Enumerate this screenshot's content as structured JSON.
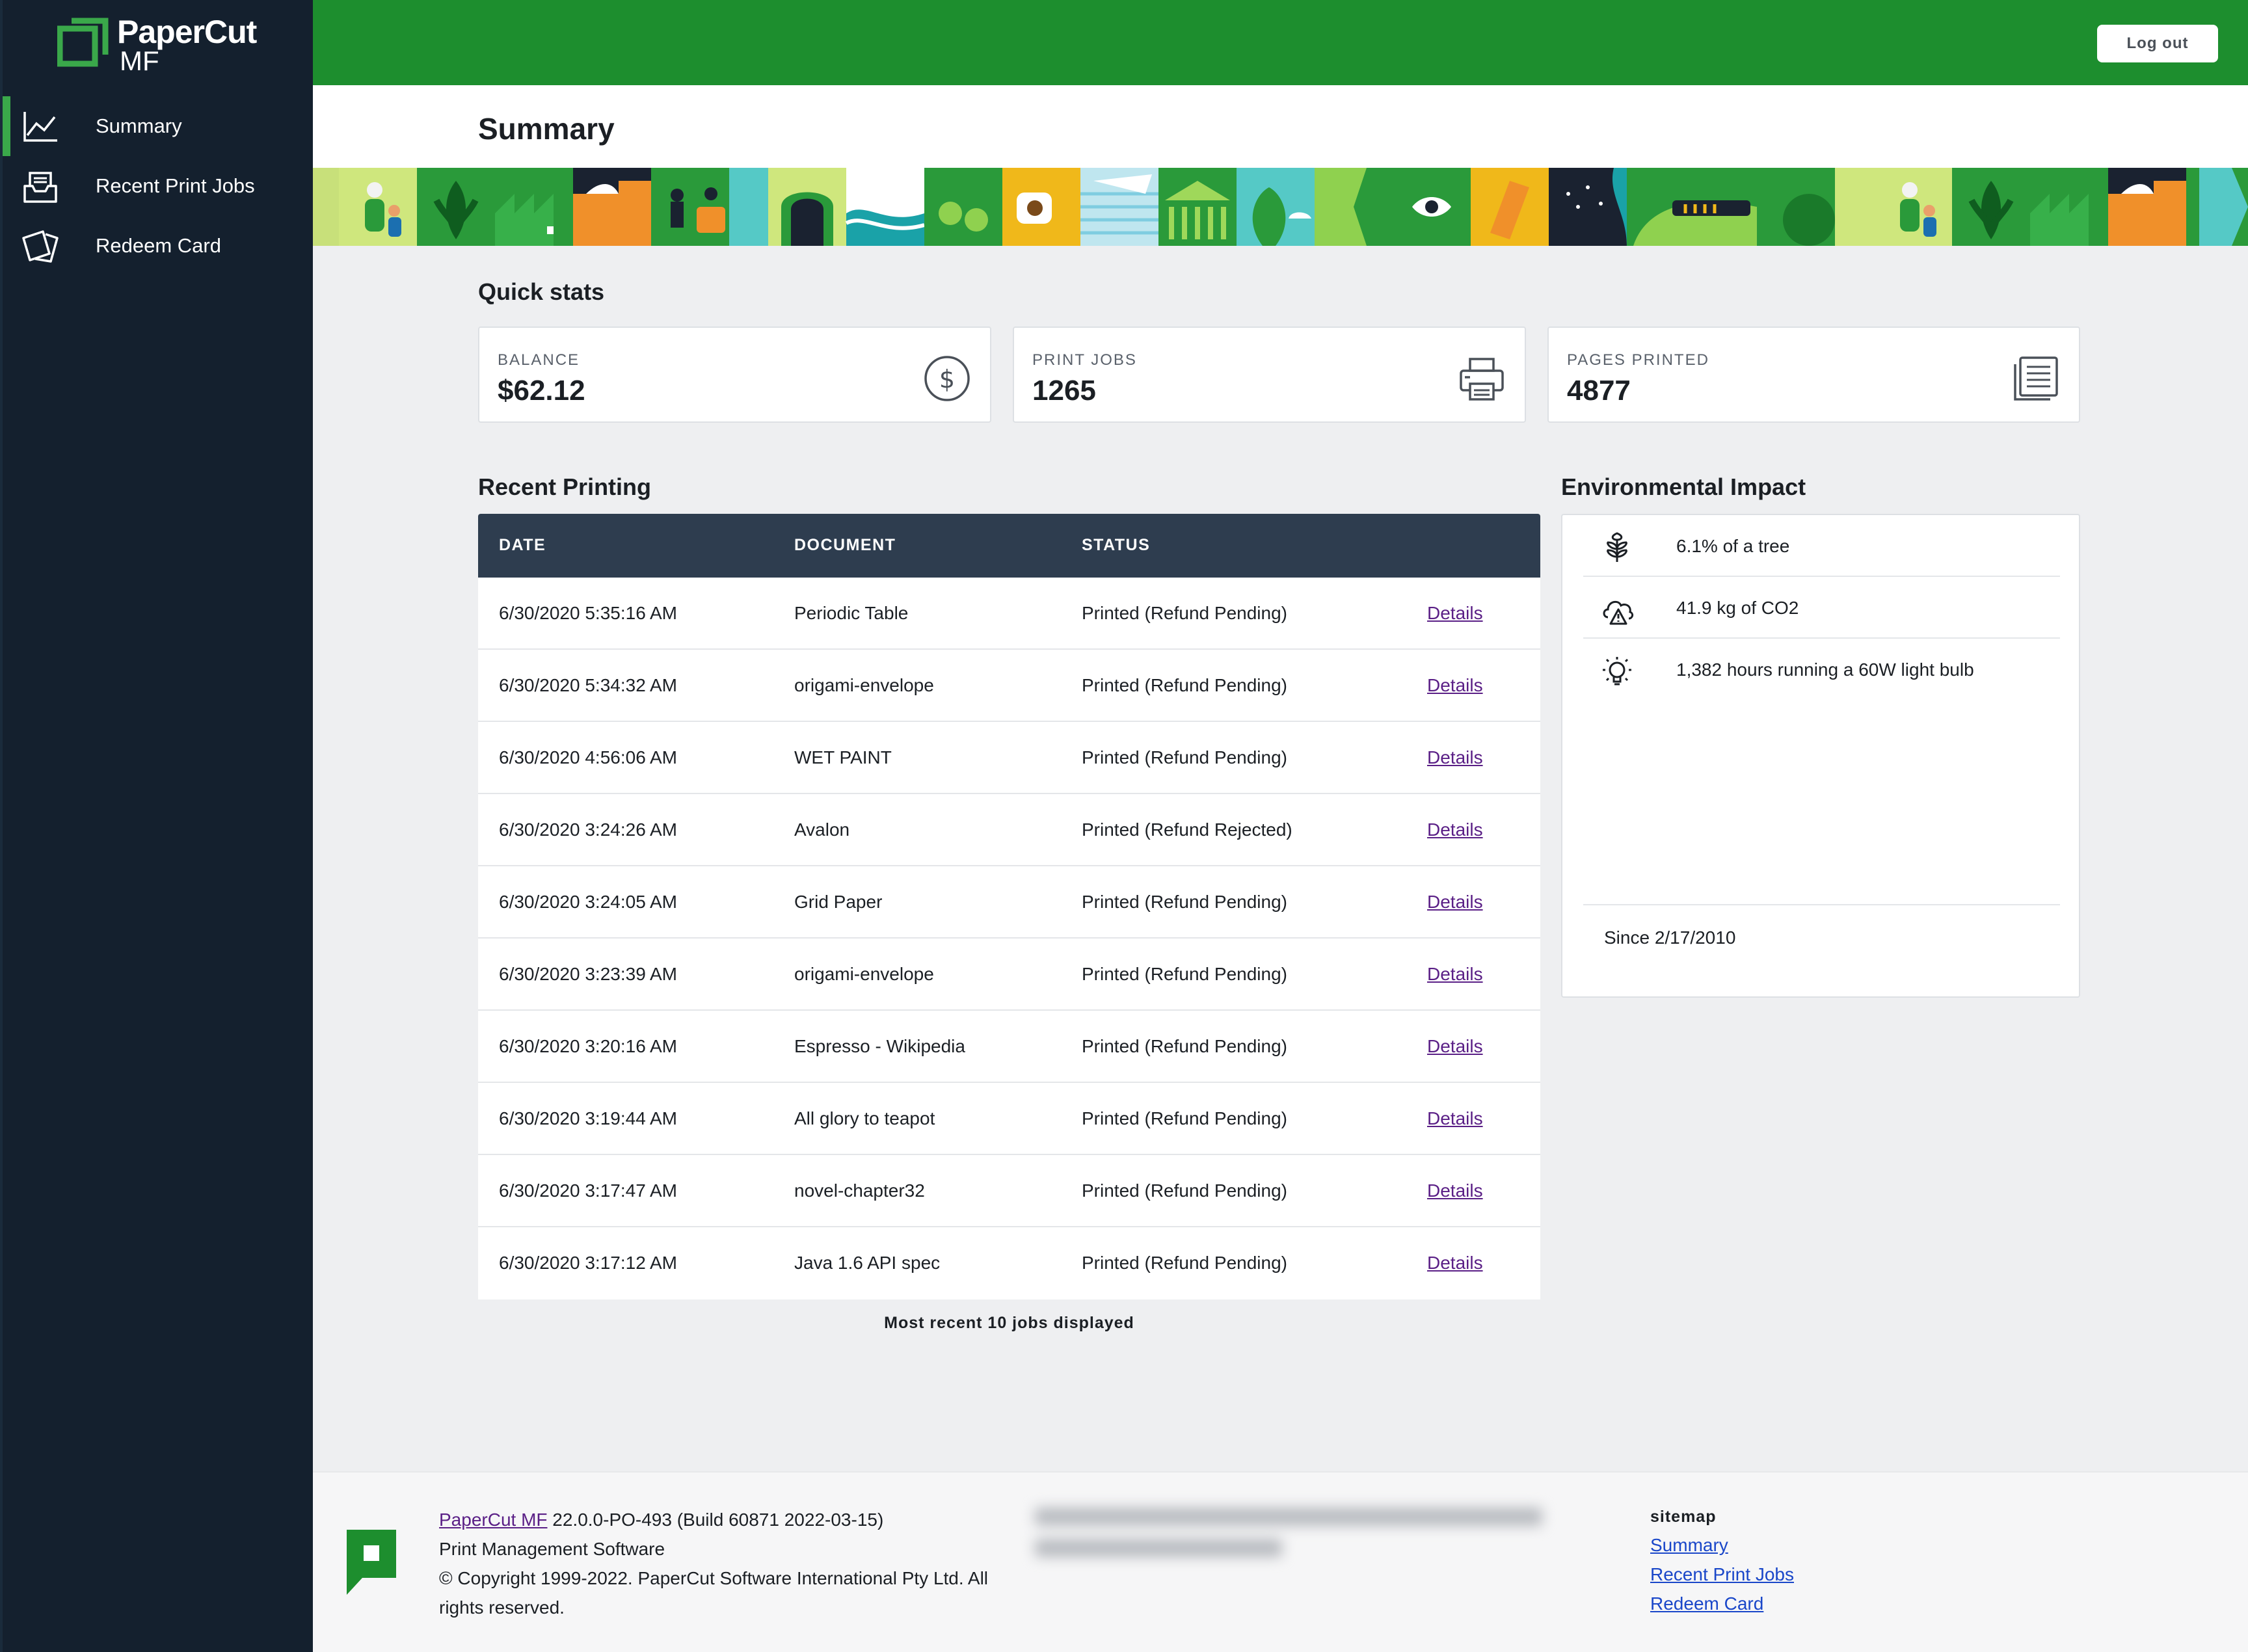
{
  "app": {
    "logo_name": "PaperCut",
    "logo_suffix": "MF",
    "logout_label": "Log out",
    "brand_color": "#1d8e2e",
    "sidebar_color": "#14202e"
  },
  "sidebar": {
    "items": [
      {
        "label": "Summary",
        "icon": "chart-line-icon",
        "active": true
      },
      {
        "label": "Recent Print Jobs",
        "icon": "print-tray-icon",
        "active": false
      },
      {
        "label": "Redeem Card",
        "icon": "cards-icon",
        "active": false
      }
    ]
  },
  "page": {
    "title": "Summary"
  },
  "quick_stats": {
    "title": "Quick stats",
    "cards": [
      {
        "label": "BALANCE",
        "value": "$62.12",
        "icon": "dollar-circle-icon"
      },
      {
        "label": "PRINT JOBS",
        "value": "1265",
        "icon": "printer-icon"
      },
      {
        "label": "PAGES PRINTED",
        "value": "4877",
        "icon": "pages-icon"
      }
    ]
  },
  "recent_printing": {
    "title": "Recent Printing",
    "columns": [
      "DATE",
      "DOCUMENT",
      "STATUS"
    ],
    "details_label": "Details",
    "rows": [
      {
        "date": "6/30/2020 5:35:16 AM",
        "document": "Periodic Table",
        "status": "Printed (Refund Pending)"
      },
      {
        "date": "6/30/2020 5:34:32 AM",
        "document": "origami-envelope",
        "status": "Printed (Refund Pending)"
      },
      {
        "date": "6/30/2020 4:56:06 AM",
        "document": "WET PAINT",
        "status": "Printed (Refund Pending)"
      },
      {
        "date": "6/30/2020 3:24:26 AM",
        "document": "Avalon",
        "status": "Printed (Refund Rejected)"
      },
      {
        "date": "6/30/2020 3:24:05 AM",
        "document": "Grid Paper",
        "status": "Printed (Refund Pending)"
      },
      {
        "date": "6/30/2020 3:23:39 AM",
        "document": "origami-envelope",
        "status": "Printed (Refund Pending)"
      },
      {
        "date": "6/30/2020 3:20:16 AM",
        "document": "Espresso - Wikipedia",
        "status": "Printed (Refund Pending)"
      },
      {
        "date": "6/30/2020 3:19:44 AM",
        "document": "All glory to teapot",
        "status": "Printed (Refund Pending)"
      },
      {
        "date": "6/30/2020 3:17:47 AM",
        "document": "novel-chapter32",
        "status": "Printed (Refund Pending)"
      },
      {
        "date": "6/30/2020 3:17:12 AM",
        "document": "Java 1.6 API spec",
        "status": "Printed (Refund Pending)"
      }
    ],
    "note": "Most recent 10 jobs displayed"
  },
  "environmental_impact": {
    "title": "Environmental Impact",
    "items": [
      {
        "text": "6.1% of a tree",
        "icon": "tree-icon"
      },
      {
        "text": "41.9 kg of CO2",
        "icon": "cloud-warning-icon"
      },
      {
        "text": "1,382 hours running a 60W light bulb",
        "icon": "light-bulb-icon"
      }
    ],
    "since": "Since 2/17/2010"
  },
  "footer": {
    "product_link": "PaperCut MF",
    "version": " 22.0.0-PO-493 (Build 60871 2022-03-15)",
    "tagline": "Print Management Software",
    "copyright": "© Copyright 1999-2022. PaperCut Software International Pty Ltd. All rights reserved.",
    "sitemap_title": "sitemap",
    "sitemap_links": [
      "Summary",
      "Recent Print Jobs",
      "Redeem Card"
    ]
  }
}
